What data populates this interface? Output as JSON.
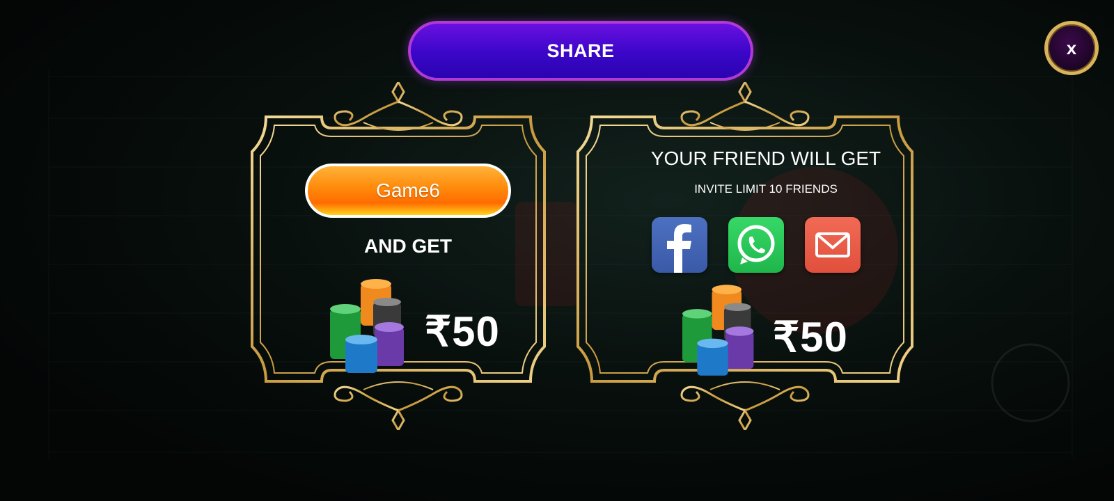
{
  "header": {
    "title": "SHARE",
    "close_label": "x"
  },
  "referral_card": {
    "game_label": "Game6",
    "and_get": "AND GET",
    "amount": "₹50"
  },
  "friend_card": {
    "title": "YOUR FRIEND WILL GET",
    "invite_limit": "INVITE LIMIT 10 FRIENDS",
    "amount": "₹50",
    "share_options": [
      {
        "name": "facebook",
        "icon": "facebook-icon",
        "color": "#3b5ba9"
      },
      {
        "name": "whatsapp",
        "icon": "whatsapp-icon",
        "color": "#25c45a"
      },
      {
        "name": "email",
        "icon": "mail-icon",
        "color": "#e85a45"
      }
    ]
  },
  "colors": {
    "banner": "#4a08d0",
    "banner_border": "#b23ad6",
    "gold": "#d9b45a",
    "game_button": "#ff8a0a"
  }
}
